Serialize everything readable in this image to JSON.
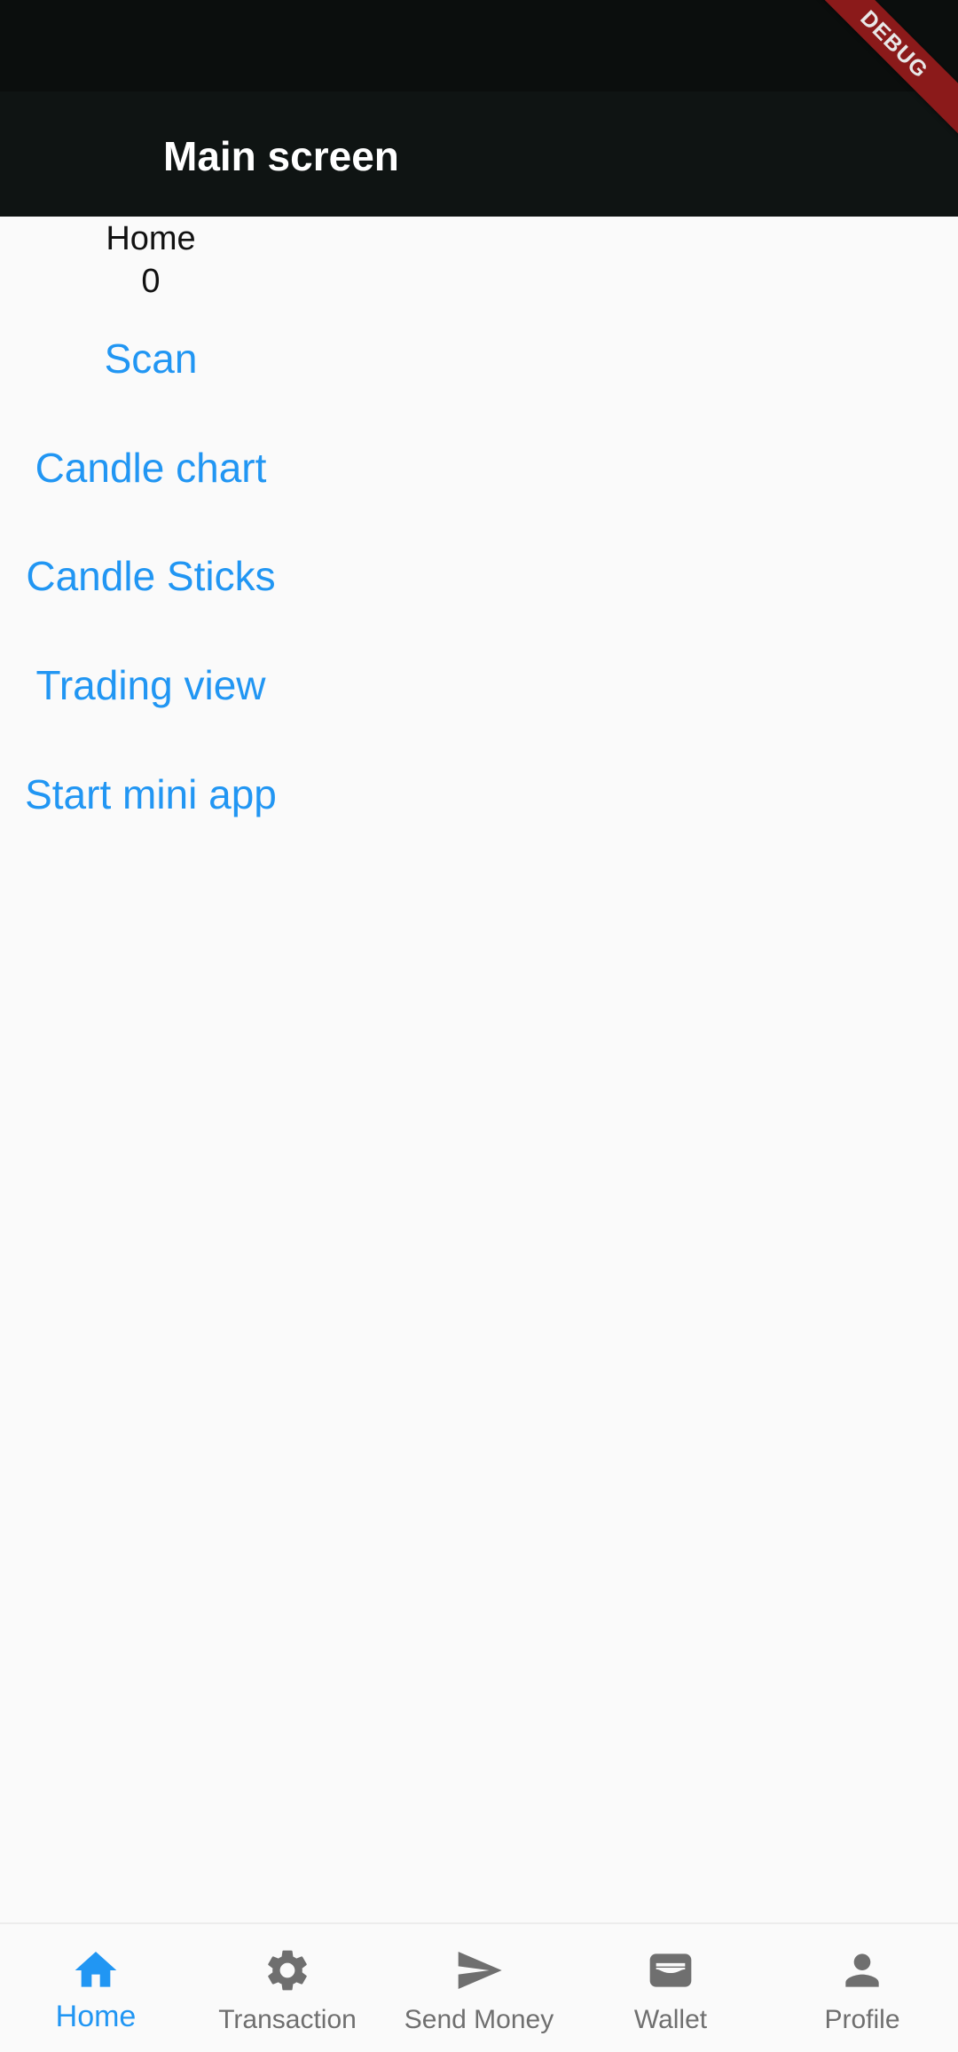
{
  "app_bar": {
    "title": "Main screen",
    "debug_banner": "DEBUG"
  },
  "main": {
    "home_label": "Home",
    "counter": "0",
    "buttons": [
      {
        "label": "Scan"
      },
      {
        "label": "Candle chart"
      },
      {
        "label": "Candle Sticks"
      },
      {
        "label": "Trading view"
      },
      {
        "label": "Start mini app"
      }
    ]
  },
  "bottom_nav": {
    "active_index": 0,
    "items": [
      {
        "label": "Home",
        "icon": "home-icon"
      },
      {
        "label": "Transaction",
        "icon": "gear-icon"
      },
      {
        "label": "Send Money",
        "icon": "send-icon"
      },
      {
        "label": "Wallet",
        "icon": "wallet-icon"
      },
      {
        "label": "Profile",
        "icon": "person-icon"
      }
    ]
  },
  "colors": {
    "accent": "#2196f3",
    "inactive": "#6f6f6f",
    "app_bar": "#0f1413",
    "status_bar": "#0b0e0d",
    "background": "#fafafa",
    "debug_banner": "#8b1a1a"
  }
}
